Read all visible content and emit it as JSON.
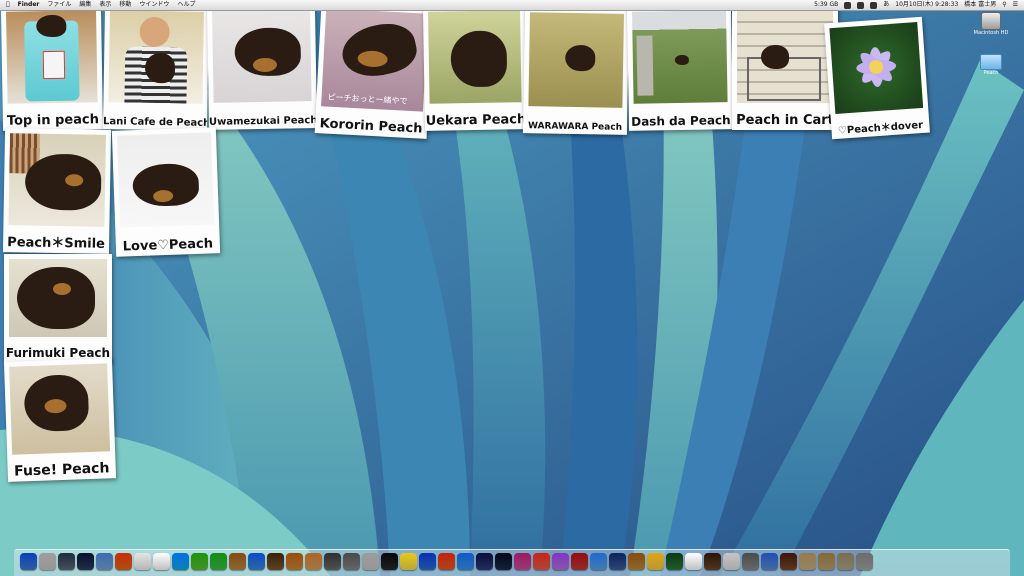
{
  "menubar": {
    "app_name": "Finder",
    "menus": [
      "ファイル",
      "編集",
      "表示",
      "移動",
      "ウインドウ",
      "ヘルプ"
    ],
    "battery": "5:39 GB",
    "input_method": "あ",
    "datetime": "10月10日(木) 9:28:33",
    "user": "橋本 富士男"
  },
  "desktop_icons": [
    {
      "label": "Macintosh HD"
    },
    {
      "label": "Peach"
    }
  ],
  "polaroids": [
    {
      "caption": "Top in peach"
    },
    {
      "caption": "Lani Cafe de Peach"
    },
    {
      "caption": "Uwamezukai Peach"
    },
    {
      "caption": "Kororin Peach",
      "overlay_text": "ピーチおっとー緒やで"
    },
    {
      "caption": "Uekara Peach"
    },
    {
      "caption": "WARAWARA Peach"
    },
    {
      "caption": "Dash da Peach"
    },
    {
      "caption": "Peach in Cart"
    },
    {
      "caption": "♡Peach＊dover"
    },
    {
      "caption": "Peach＊Smile"
    },
    {
      "caption": "Love♡Peach"
    },
    {
      "caption": "Furimuki Peach"
    },
    {
      "caption": "Fuse! Peach"
    }
  ],
  "dock": {
    "items": [
      "finder-icon",
      "launchpad-icon",
      "mission-control-icon",
      "dashboard-icon",
      "preview-icon",
      "firefox-icon",
      "calendar-icon",
      "textedit-icon",
      "skype-icon",
      "messages-icon",
      "line-icon",
      "book-icon",
      "safari-icon",
      "script-icon",
      "guitar-icon",
      "photo-icon",
      "photo-booth-icon",
      "camera-icon",
      "calculator-icon",
      "dvd-icon",
      "stickies-icon",
      "itunes-icon",
      "garageband-icon",
      "app-store-icon",
      "music-icon",
      "quicktime-icon",
      "photos-icon",
      "iphoto-icon",
      "flower-icon",
      "record-icon",
      "bird-icon",
      "world-icon",
      "contacts-icon",
      "notes-icon",
      "time-machine-icon",
      "finder-2-icon",
      "chess-icon",
      "font-icon",
      "settings-icon",
      "puzzle-icon",
      "dog-icon",
      "folder-icon",
      "downloads-icon",
      "documents-icon",
      "trash-icon"
    ],
    "colors": [
      "#3c7fd9",
      "#c9c9c9",
      "#5a6b7c",
      "#2b3f66",
      "#7aa6d6",
      "#e46a1c",
      "#f1f1f1",
      "#ffffff",
      "#12aaf0",
      "#5bc236",
      "#3fbf4a",
      "#b88a45",
      "#3a8be0",
      "#7a5a2e",
      "#c98a3a",
      "#d3a060",
      "#6d6d6d",
      "#888888",
      "#c8c8c8",
      "#2a2a2a",
      "#f4e14b",
      "#2b6fd6",
      "#e25d2c",
      "#3a97e6",
      "#2e3d7c",
      "#1d2b4f",
      "#c94f9f",
      "#e35f4d",
      "#b575e0",
      "#c23a3a",
      "#5aa5e6",
      "#3c5f9c",
      "#bb8a3a",
      "#f1cc46",
      "#2d7a3d",
      "#ffffff",
      "#6a4a2a",
      "#e0e0e0",
      "#8a8a8a",
      "#5b8ed6",
      "#7a4a2a",
      "#c4b187",
      "#b9a273",
      "#b0a78f",
      "#a6a6a6"
    ]
  },
  "colors": {
    "menubar": "#e6e6e6",
    "polaroid": "#fdfdfd",
    "wallpaper_dark": "#2f6f99",
    "wallpaper_light": "#56b0b5"
  }
}
